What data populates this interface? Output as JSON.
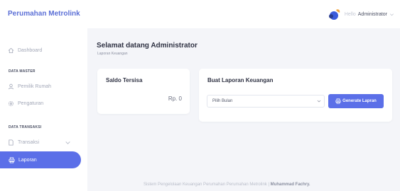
{
  "sidebar": {
    "brand": "Perumahan Metrolink",
    "dashboard_label": "Dashboard",
    "section_master": "DATA MASTER",
    "pemilik_label": "Pemilik Rumah",
    "pengaturan_label": "Pengaturan",
    "section_transaksi": "DATA TRANSAKSI",
    "transaksi_label": "Transaksi",
    "laporan_label": "Laporan",
    "active_color": "#5b6fe8"
  },
  "header": {
    "greeting": "Hello",
    "user_name": "Administrator"
  },
  "main": {
    "welcome": "Selamat datang Administrator",
    "breadcrumb": "Laporan Keuangan",
    "saldo": {
      "title": "Saldo Tersisa",
      "value": "Rp. 0"
    },
    "laporan": {
      "title": "Buat Laporan Keuangan",
      "select_value": "Pilih Bulan",
      "button_label": "Generate Lapran"
    }
  },
  "footer": {
    "text": "Sistem Pengelolaan Keuangan Perumahan Perumahan Metrolink |",
    "author": "Muhammad Fachry."
  }
}
